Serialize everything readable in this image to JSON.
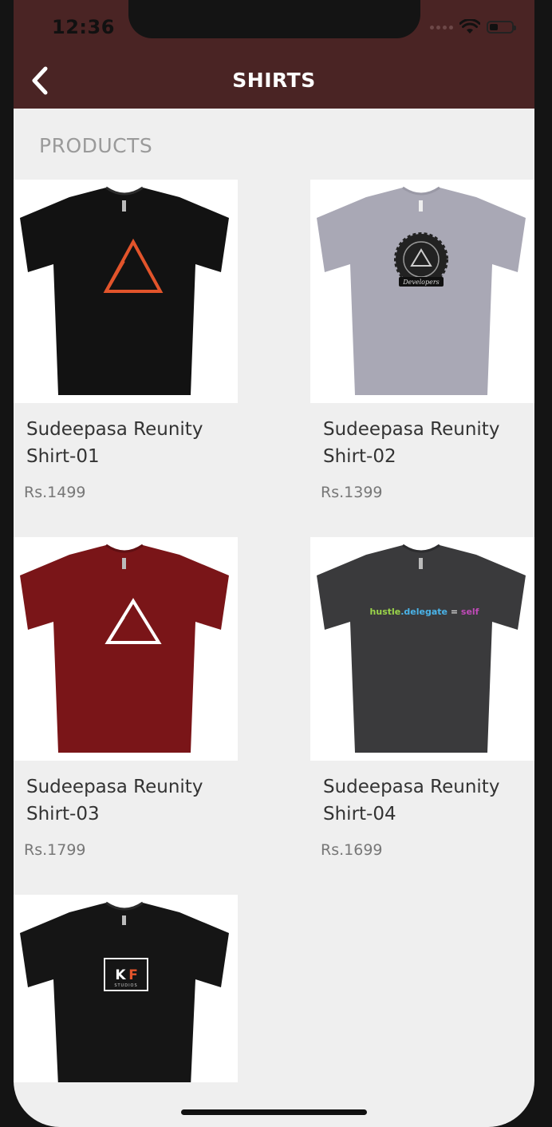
{
  "status": {
    "time": "12:36"
  },
  "header": {
    "title": "SHIRTS"
  },
  "section": {
    "label": "PRODUCTS"
  },
  "products": [
    {
      "name_line1": "Sudeepasa Reunity",
      "name_line2": "Shirt-01",
      "price": "Rs.1499",
      "shirt_color": "#121212",
      "graphic": "orange-mountain-logo"
    },
    {
      "name_line1": "Sudeepasa Reunity",
      "name_line2": "Shirt-02",
      "price": "Rs.1399",
      "shirt_color": "#a9a8b5",
      "graphic": "emblem-badge"
    },
    {
      "name_line1": "Sudeepasa Reunity",
      "name_line2": "Shirt-03",
      "price": "Rs.1799",
      "shirt_color": "#7a1518",
      "graphic": "white-mountain-logo"
    },
    {
      "name_line1": "Sudeepasa Reunity",
      "name_line2": "Shirt-04",
      "price": "Rs.1699",
      "shirt_color": "#3a3a3c",
      "graphic": "hustle-text",
      "graphic_text": [
        "hustle",
        ".delegate",
        " = ",
        "self"
      ]
    },
    {
      "shirt_color": "#151515",
      "graphic": "kf-studios-logo",
      "graphic_text": [
        "K",
        "F",
        "STUDIOS"
      ]
    }
  ],
  "colors": {
    "header": "#4a2424",
    "background": "#efefef",
    "accent_orange": "#e2542b"
  }
}
